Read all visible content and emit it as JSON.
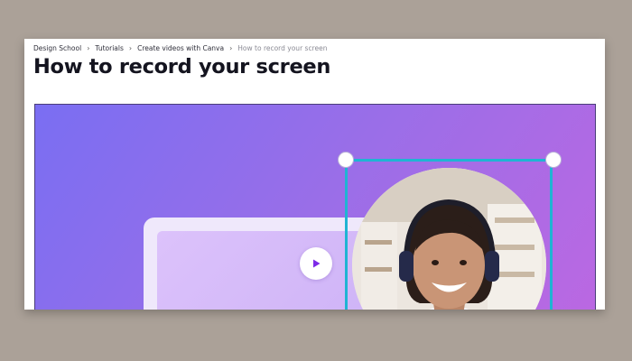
{
  "breadcrumb": {
    "items": [
      {
        "label": "Design School"
      },
      {
        "label": "Tutorials"
      },
      {
        "label": "Create videos with Canva"
      }
    ],
    "current": "How to record your screen",
    "separator_icon": "chevron-right-icon"
  },
  "page": {
    "title": "How to record your screen"
  },
  "hero": {
    "gradient_start": "#7a6ef2",
    "gradient_end": "#bb68e2",
    "selection_color": "#1fb4d3",
    "play_icon": "play-icon",
    "play_color": "#7d2ae8"
  }
}
